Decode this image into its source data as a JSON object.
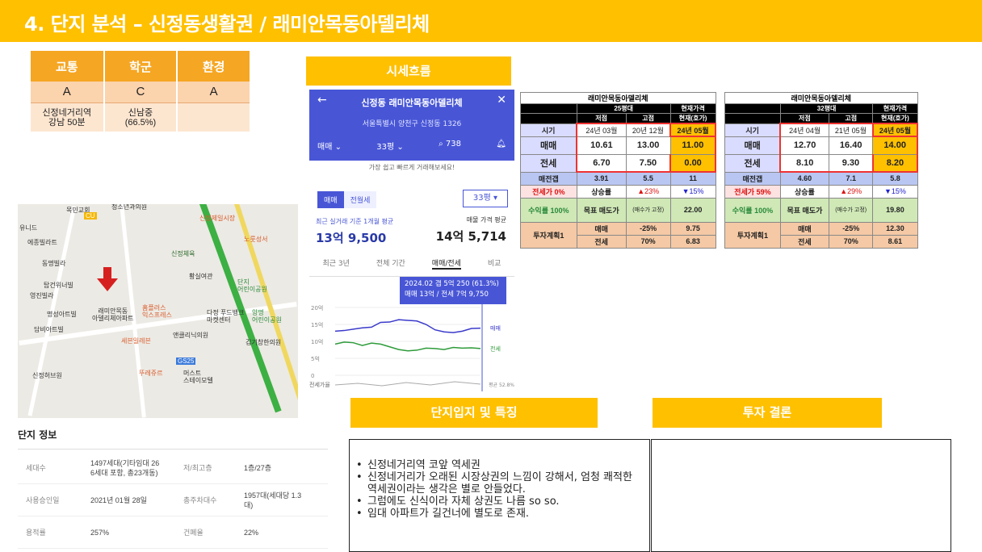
{
  "title": "4. 단지 분석 – 신정동생활권 / 래미안목동아델리체",
  "rating": {
    "headers": [
      "교통",
      "학군",
      "환경"
    ],
    "grades": [
      "A",
      "C",
      "A"
    ],
    "notes": [
      "신정네거리역\n강남 50분",
      "신남중\n(66.5%)",
      ""
    ]
  },
  "map": {
    "labels": [
      "목민교회",
      "청소년과의원",
      "유니드",
      "에종빌라트",
      "동명빌라",
      "탑건위너빌",
      "영진빌라",
      "명성아트빌",
      "래미안목동\n아델리체아파트",
      "담비아트빌",
      "신정허브원",
      "신정제일시장",
      "노룻성서",
      "홈플러스\n익스프레스",
      "다정 푸드뱅크\n마켓센터",
      "앤클리닉의원",
      "세븐일레븐",
      "뚜레쥬르",
      "머스트\n스테이모텔",
      "김기창한의원",
      "양명\n어린이공원",
      "단지\n어린이공원",
      "황실여관",
      "신정체육",
      "CU",
      "GS25"
    ]
  },
  "info": {
    "title": "단지 정보",
    "rows": [
      {
        "k": "세대수",
        "v": "1497세대(기타임대 26\n6세대 포함, 총23개동)",
        "k2": "저/최고층",
        "v2": "1층/27층"
      },
      {
        "k": "사용승인일",
        "v": "2021년 01월 28일",
        "k2": "총주차대수",
        "v2": "1957대(세대당 1.3\n대)"
      },
      {
        "k": "용적률",
        "v": "257%",
        "k2": "건폐율",
        "v2": "22%"
      }
    ]
  },
  "labels": {
    "price_flow": "시세흐름",
    "features": "단지입지 및 특징",
    "conclusion": "투자 결론"
  },
  "app": {
    "title": "신정동 래미안목동아델리체",
    "address": "서울특별시 양천구 신정동 1326",
    "tab_trade": "매매",
    "tab_size": "33평",
    "tab_count": "738",
    "note": "가장 쉽고 빠르게 거래해보세요!",
    "seg_trade": "매매",
    "seg_rent": "전월세",
    "pyeong": "33평",
    "avg_label": "최근 실거래 기준 1개월 평균",
    "avg_value": "13억 9,500",
    "ask_label": "매물 가격 평균",
    "ask_value": "14억 5,714",
    "periods": [
      "최근 3년",
      "전체 기간",
      "매매/전세",
      "비교"
    ],
    "tooltip_1": "2024.02  갭 5억 250 (61.3%)",
    "tooltip_2": "매매 13억 / 전세 7억 9,750",
    "y_ticks": [
      "20억",
      "15억",
      "10억",
      "5억",
      "0"
    ],
    "legend_trade": "매매",
    "legend_rent": "전세",
    "legend_ratio": "평균\n52.8%",
    "ratio_label": "전세가율"
  },
  "chart_data": {
    "type": "line",
    "ylabel": "",
    "ylim": [
      0,
      20
    ],
    "series": [
      {
        "name": "매매",
        "values": [
          13.0,
          13.2,
          13.6,
          14.0,
          14.2,
          15.6,
          15.7,
          16.4,
          16.2,
          16.0,
          15.0,
          13.4,
          12.8,
          12.6,
          13.0,
          13.8,
          13.9
        ]
      },
      {
        "name": "전세",
        "values": [
          9.2,
          9.8,
          9.6,
          8.8,
          9.5,
          9.2,
          8.4,
          7.6,
          7.2,
          7.4,
          8.0,
          7.9,
          7.6,
          8.2,
          8.0,
          8.1,
          7.9
        ]
      }
    ]
  },
  "table25": {
    "title": "래미안목동아델리체",
    "size": "25평대",
    "current_hdr": "현재가격",
    "cols": [
      "저점",
      "고점",
      "현재(호가)"
    ],
    "dates": [
      "24년 03월",
      "20년 12월",
      "24년 05월"
    ],
    "trade": [
      "10.61",
      "13.00",
      "11.00"
    ],
    "rent": [
      "6.70",
      "7.50",
      "0.00"
    ],
    "gap": [
      "3.91",
      "5.5",
      "11"
    ],
    "ratio": "전세가 0%",
    "rise": [
      "상승률",
      "▲23%",
      "▼15%"
    ],
    "target_yield": "수익률 100%",
    "target_label": "목표 매도가",
    "target_note": "(매수가 고정)",
    "target_value": "22.00",
    "plan": "투자계획1",
    "plan_trade": [
      "매매",
      "-25%",
      "9.75"
    ],
    "plan_rent": [
      "전세",
      "70%",
      "6.83"
    ],
    "row_labels": [
      "시기",
      "매매",
      "전세",
      "매전갭"
    ]
  },
  "table32": {
    "title": "래미안목동아델리체",
    "size": "32평대",
    "current_hdr": "현재가격",
    "cols": [
      "저점",
      "고점",
      "현재(호가)"
    ],
    "dates": [
      "24년 04월",
      "21년 05월",
      "24년 05월"
    ],
    "trade": [
      "12.70",
      "16.40",
      "14.00"
    ],
    "rent": [
      "8.10",
      "9.30",
      "8.20"
    ],
    "gap": [
      "4.60",
      "7.1",
      "5.8"
    ],
    "ratio": "전세가 59%",
    "rise": [
      "상승률",
      "▲29%",
      "▼15%"
    ],
    "target_yield": "수익률 100%",
    "target_label": "목표 매도가",
    "target_note": "(매수가 고정)",
    "target_value": "19.80",
    "plan": "투자계획1",
    "plan_trade": [
      "매매",
      "-25%",
      "12.30"
    ],
    "plan_rent": [
      "전세",
      "70%",
      "8.61"
    ],
    "row_labels": [
      "시기",
      "매매",
      "전세",
      "매전갭"
    ]
  },
  "features": [
    "신정네거리역 코앞 역세권",
    "신정네거리가 오래된 시장상권의 느낌이 강해서, 엄청 쾌적한 역세권이라는 생각은 별로 안들었다.",
    "그럼에도 신식이라 자체 상권도 나름 so so.",
    "임대 아파트가 길건너에 별도로 존재."
  ],
  "colors": {
    "accent": "#ffc000",
    "brand": "#4856d6",
    "trade_line": "#3a3acb",
    "rent_line": "#2e9b3a"
  }
}
